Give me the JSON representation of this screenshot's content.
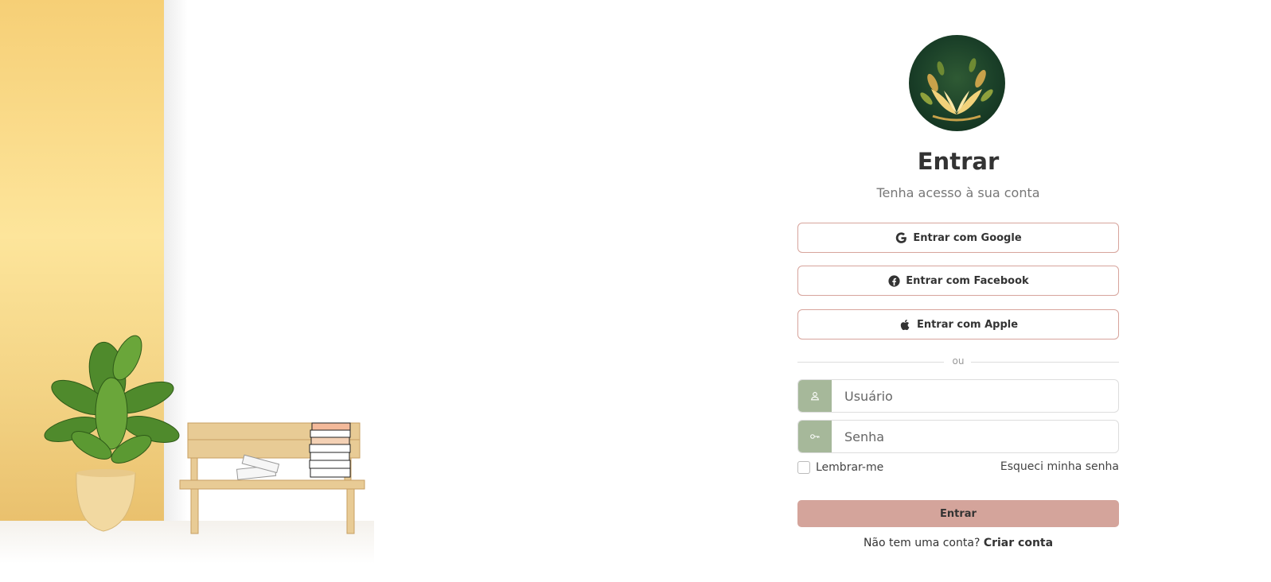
{
  "login": {
    "title": "Entrar",
    "subtitle": "Tenha acesso à sua conta",
    "google_label": "Entrar com Google",
    "facebook_label": "Entrar com Facebook",
    "apple_label": "Entrar com Apple",
    "divider_text": "ou",
    "username_placeholder": "Usuário",
    "password_placeholder": "Senha",
    "remember_label": "Lembrar-me",
    "forgot_label": "Esqueci minha senha",
    "submit_label": "Entrar",
    "signup_prompt": "Não tem uma conta?",
    "signup_link": "Criar conta"
  },
  "colors": {
    "accent_button": "#d4a49b",
    "social_border": "#d7a49c",
    "input_addon": "#a6b89a",
    "logo_background": "#1a3f28",
    "wall_yellow": "#fde59b"
  },
  "icons": {
    "google": "google-icon",
    "facebook": "facebook-icon",
    "apple": "apple-icon",
    "user": "user-icon",
    "key": "key-icon",
    "logo": "open-book-leaves-logo"
  }
}
